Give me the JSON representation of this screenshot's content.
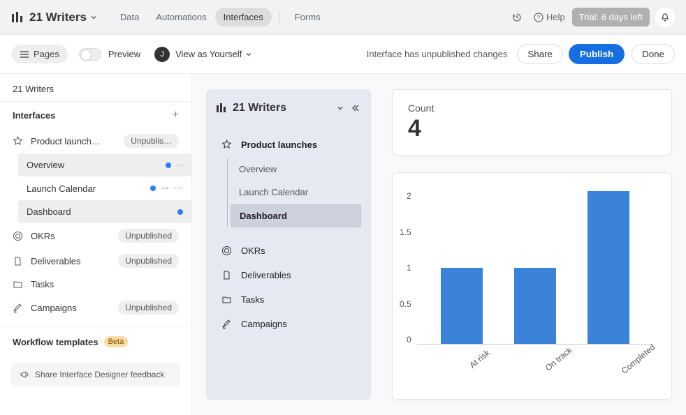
{
  "app": {
    "title": "21 Writers"
  },
  "topnav": {
    "tabs": [
      "Data",
      "Automations",
      "Interfaces",
      "Forms"
    ],
    "help": "Help",
    "trial": "Trial: 6 days left"
  },
  "secondbar": {
    "pages": "Pages",
    "preview": "Preview",
    "avatar_letter": "J",
    "viewas": "View as Yourself",
    "unpublished_msg": "Interface has unpublished changes",
    "share": "Share",
    "publish": "Publish",
    "done": "Done"
  },
  "sidebar": {
    "crumb": "21 Writers",
    "interfaces_header": "Interfaces",
    "product_launch": {
      "label": "Product launch…",
      "badge": "Unpublis…"
    },
    "pages": {
      "overview": "Overview",
      "launch_calendar": "Launch Calendar",
      "dashboard": "Dashboard"
    },
    "items": [
      {
        "label": "OKRs",
        "badge": "Unpublished"
      },
      {
        "label": "Deliverables",
        "badge": "Unpublished"
      },
      {
        "label": "Tasks",
        "badge": ""
      },
      {
        "label": "Campaigns",
        "badge": "Unpublished"
      }
    ],
    "workflow_header": "Workflow templates",
    "beta": "Beta",
    "feedback": "Share Interface Designer feedback"
  },
  "navpanel": {
    "title": "21 Writers",
    "group": "Product launches",
    "pages": [
      "Overview",
      "Launch Calendar",
      "Dashboard"
    ],
    "items": [
      "OKRs",
      "Deliverables",
      "Tasks",
      "Campaigns"
    ]
  },
  "card": {
    "count_label": "Count",
    "count_value": "4"
  },
  "chart_data": {
    "type": "bar",
    "categories": [
      "At risk",
      "On track",
      "Completed"
    ],
    "values": [
      1,
      1,
      2
    ],
    "ylim": [
      0,
      2
    ],
    "yticks": [
      "2",
      "1.5",
      "1",
      "0.5",
      "0"
    ]
  }
}
